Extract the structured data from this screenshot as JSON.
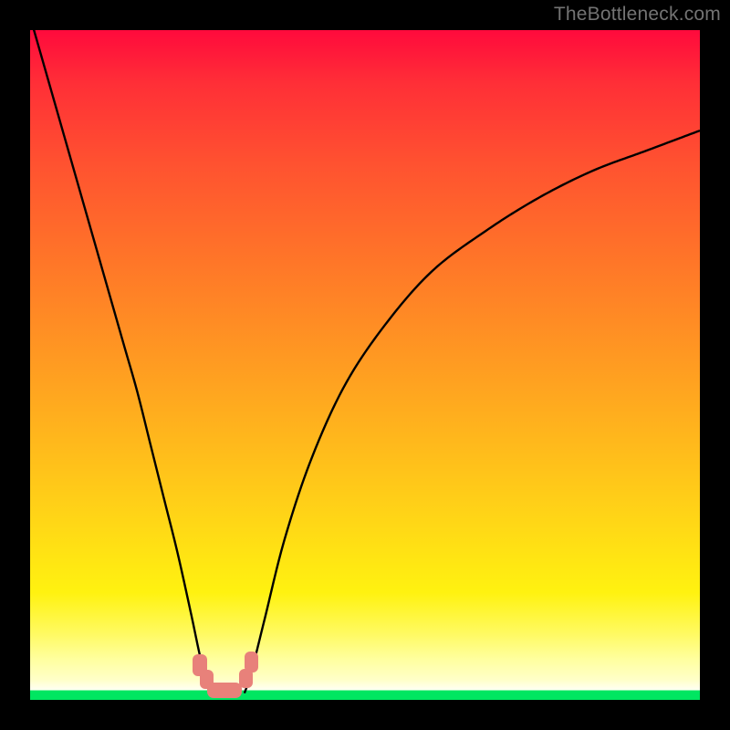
{
  "watermark": "TheBottleneck.com",
  "chart_data": {
    "type": "line",
    "title": "",
    "xlabel": "",
    "ylabel": "",
    "xlim": [
      0,
      100
    ],
    "ylim": [
      0,
      100
    ],
    "series": [
      {
        "name": "left-branch",
        "x": [
          0,
          2,
          4,
          6,
          8,
          10,
          12,
          14,
          16,
          18,
          20,
          22,
          24,
          25.5,
          26.5,
          27.7
        ],
        "y": [
          102,
          95,
          88,
          81,
          74,
          67,
          60,
          53,
          46,
          38,
          30,
          22,
          13,
          6,
          3,
          1
        ]
      },
      {
        "name": "right-branch",
        "x": [
          32,
          33,
          35,
          38,
          42,
          47,
          53,
          60,
          68,
          76,
          84,
          92,
          100
        ],
        "y": [
          1,
          4,
          12,
          24,
          36,
          47,
          56,
          64,
          70,
          75,
          79,
          82,
          85
        ]
      }
    ],
    "markers": [
      {
        "name": "left-dot-top",
        "x": 25.3,
        "y": 5.2
      },
      {
        "name": "left-dot-mid",
        "x": 26.4,
        "y": 3.0
      },
      {
        "name": "valley-bar",
        "x": 29.0,
        "y": 1.4
      },
      {
        "name": "right-dot-lower",
        "x": 32.2,
        "y": 3.2
      },
      {
        "name": "right-dot-upper",
        "x": 33.0,
        "y": 5.7
      }
    ],
    "gradient_stops": [
      {
        "pos": 0.0,
        "color": "#ff0a3c"
      },
      {
        "pos": 0.55,
        "color": "#ffa81f"
      },
      {
        "pos": 0.84,
        "color": "#fff210"
      },
      {
        "pos": 0.975,
        "color": "#fffff0"
      },
      {
        "pos": 0.986,
        "color": "#00e661"
      },
      {
        "pos": 1.0,
        "color": "#00e661"
      }
    ]
  }
}
